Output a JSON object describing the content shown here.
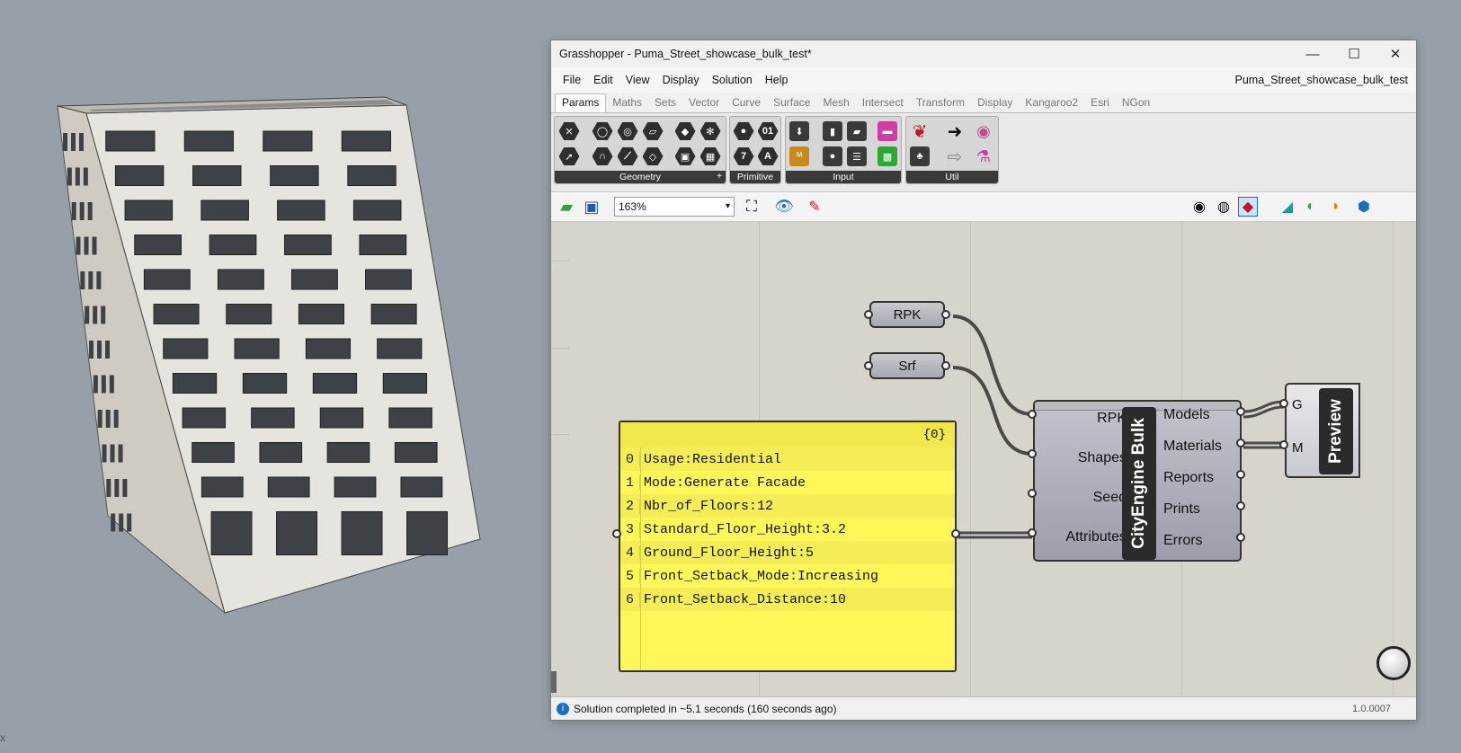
{
  "viewport": {
    "axis_label": "x"
  },
  "window": {
    "title": "Grasshopper - Puma_Street_showcase_bulk_test*",
    "minimize": "—",
    "maximize": "☐",
    "close": "✕"
  },
  "menu": {
    "items": [
      "File",
      "Edit",
      "View",
      "Display",
      "Solution",
      "Help"
    ],
    "document_name": "Puma_Street_showcase_bulk_test"
  },
  "tabs": [
    "Params",
    "Maths",
    "Sets",
    "Vector",
    "Curve",
    "Surface",
    "Mesh",
    "Intersect",
    "Transform",
    "Display",
    "Kangaroo2",
    "Esri",
    "NGon"
  ],
  "active_tab": "Params",
  "ribbon": {
    "panels": [
      "Geometry",
      "Primitive",
      "Input",
      "Util"
    ],
    "more": "+"
  },
  "toolbar": {
    "zoom": "163%"
  },
  "canvas": {
    "params": [
      {
        "label": "RPK"
      },
      {
        "label": "Srf"
      }
    ],
    "panel": {
      "path": "{0}",
      "rows": [
        {
          "index": "0",
          "text": "Usage:Residential"
        },
        {
          "index": "1",
          "text": "Mode:Generate Facade"
        },
        {
          "index": "2",
          "text": "Nbr_of_Floors:12"
        },
        {
          "index": "3",
          "text": "Standard_Floor_Height:3.2"
        },
        {
          "index": "4",
          "text": "Ground_Floor_Height:5"
        },
        {
          "index": "5",
          "text": "Front_Setback_Mode:Increasing"
        },
        {
          "index": "6",
          "text": "Front_Setback_Distance:10"
        }
      ]
    },
    "component": {
      "name": "CityEngine Bulk",
      "inputs": [
        "RPK",
        "Shapes",
        "Seed",
        "Attributes"
      ],
      "outputs": [
        "Models",
        "Materials",
        "Reports",
        "Prints",
        "Errors"
      ]
    },
    "preview": {
      "name": "Preview",
      "inputs": [
        "G",
        "M"
      ]
    }
  },
  "status": {
    "message": "Solution completed in ~5.1 seconds (160 seconds ago)",
    "version": "1.0.0007"
  },
  "colors": {
    "panel_yellow": "#fef75a",
    "canvas": "#d7d4cb",
    "background": "#97a0a8"
  }
}
